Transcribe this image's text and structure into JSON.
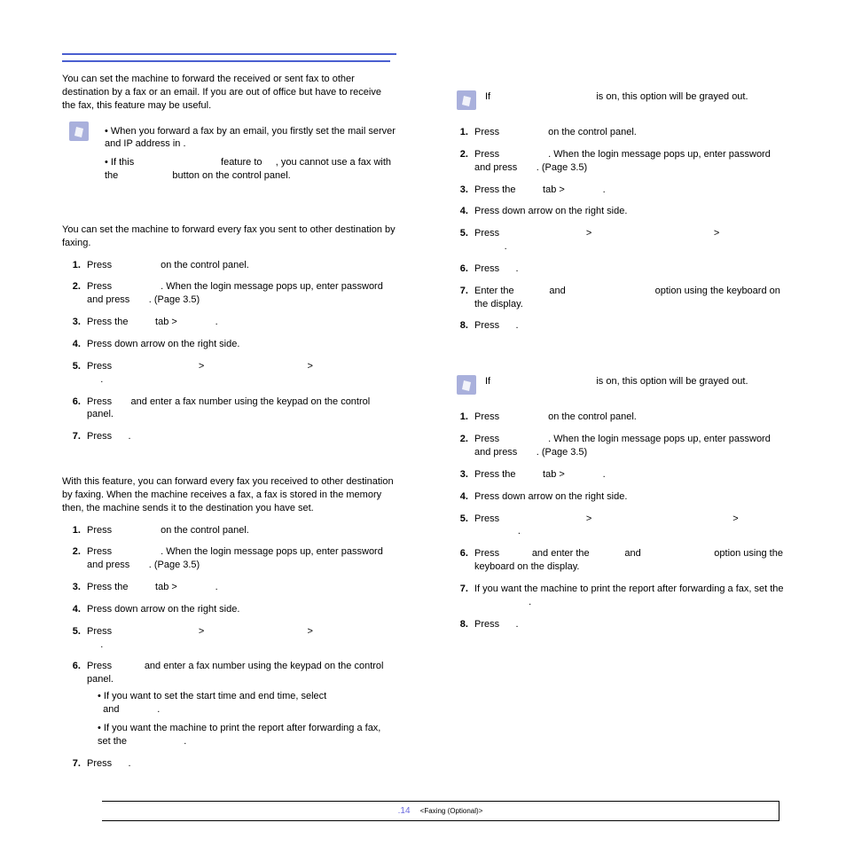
{
  "left": {
    "heading1_intro": "You can set the machine to forward the received or sent fax to other destination by a fax or an email. If you are out of office but have to receive the fax, this feature may be useful.",
    "note_bullets": {
      "b1a": "When you forward a fax by an email, you firstly set the mail server and IP address in",
      "b1b": ".",
      "b2a": "If this",
      "b2b": "feature to",
      "b2c": ", you cannot use a fax with the",
      "b2d": "button on the control panel."
    },
    "send_fwd_intro": "You can set the machine to forward every fax you sent to other destination by faxing.",
    "send_steps": {
      "s1a": "Press",
      "s1b": "on the control panel.",
      "s2a": "Press",
      "s2b": ". When the login message pops up, enter password and press",
      "s2c": ". (Page 3.5)",
      "s3a": "Press the",
      "s3b": "tab >",
      "s3c": ".",
      "s4": "Press down arrow on the right side.",
      "s5a": "Press",
      "s5b": ">",
      "s5c": ">",
      "s5d": ".",
      "s6a": "Press",
      "s6b": "and enter a fax number using the keypad on the control panel.",
      "s7a": "Press",
      "s7b": "."
    },
    "recv_fwd_intro": "With this feature, you can forward every fax you received to other destination by faxing. When the machine receives a fax, a fax is stored in the memory then, the machine sends it to the destination you have set.",
    "recv_steps": {
      "s1a": "Press",
      "s1b": "on the control panel.",
      "s2a": "Press",
      "s2b": ". When the login message pops up, enter password and press",
      "s2c": ". (Page 3.5)",
      "s3a": "Press the",
      "s3b": "tab >",
      "s3c": ".",
      "s4": "Press down arrow on the right side.",
      "s5a": "Press",
      "s5b": ">",
      "s5c": ">",
      "s5d": ".",
      "s6a": "Press",
      "s6b": "and enter a fax number using the keypad on the control panel.",
      "bul1a": "If you want to set the start time and end time, select",
      "bul1b": "and",
      "bul1c": ".",
      "bul2a": "If you want the machine to print the report after forwarding a fax, set the",
      "bul2b": ".",
      "s7a": "Press",
      "s7b": "."
    }
  },
  "right": {
    "note1a": "If",
    "note1b": "is on, this option will be grayed out.",
    "email_send_steps": {
      "s1a": "Press",
      "s1b": "on the control panel.",
      "s2a": "Press",
      "s2b": ". When the login message pops up, enter password and press",
      "s2c": ". (Page 3.5)",
      "s3a": "Press the",
      "s3b": "tab >",
      "s3c": ".",
      "s4": "Press down arrow on the right side.",
      "s5a": "Press",
      "s5b": ">",
      "s5c": ">",
      "s5d": ".",
      "s6a": "Press",
      "s6b": ".",
      "s7a": "Enter the",
      "s7b": "and",
      "s7c": "option using the keyboard on the display.",
      "s8a": "Press",
      "s8b": "."
    },
    "note2a": "If",
    "note2b": "is on, this option will be grayed out.",
    "email_recv_steps": {
      "s1a": "Press",
      "s1b": "on the control panel.",
      "s2a": "Press",
      "s2b": ". When the login message pops up, enter password and press",
      "s2c": ". (Page 3.5)",
      "s3a": "Press the",
      "s3b": "tab >",
      "s3c": ".",
      "s4": "Press down arrow on the right side.",
      "s5a": "Press",
      "s5b": ">",
      "s5c": ">",
      "s5d": ".",
      "s6a": "Press",
      "s6b": "and enter the",
      "s6c": "and",
      "s6d": "option using the keyboard on the display.",
      "s7a": "If you want the machine to print the report after forwarding a fax, set the",
      "s7b": ".",
      "s8a": "Press",
      "s8b": "."
    }
  },
  "footer": {
    "page_number": ".14",
    "label": "<Faxing (Optional)>"
  }
}
